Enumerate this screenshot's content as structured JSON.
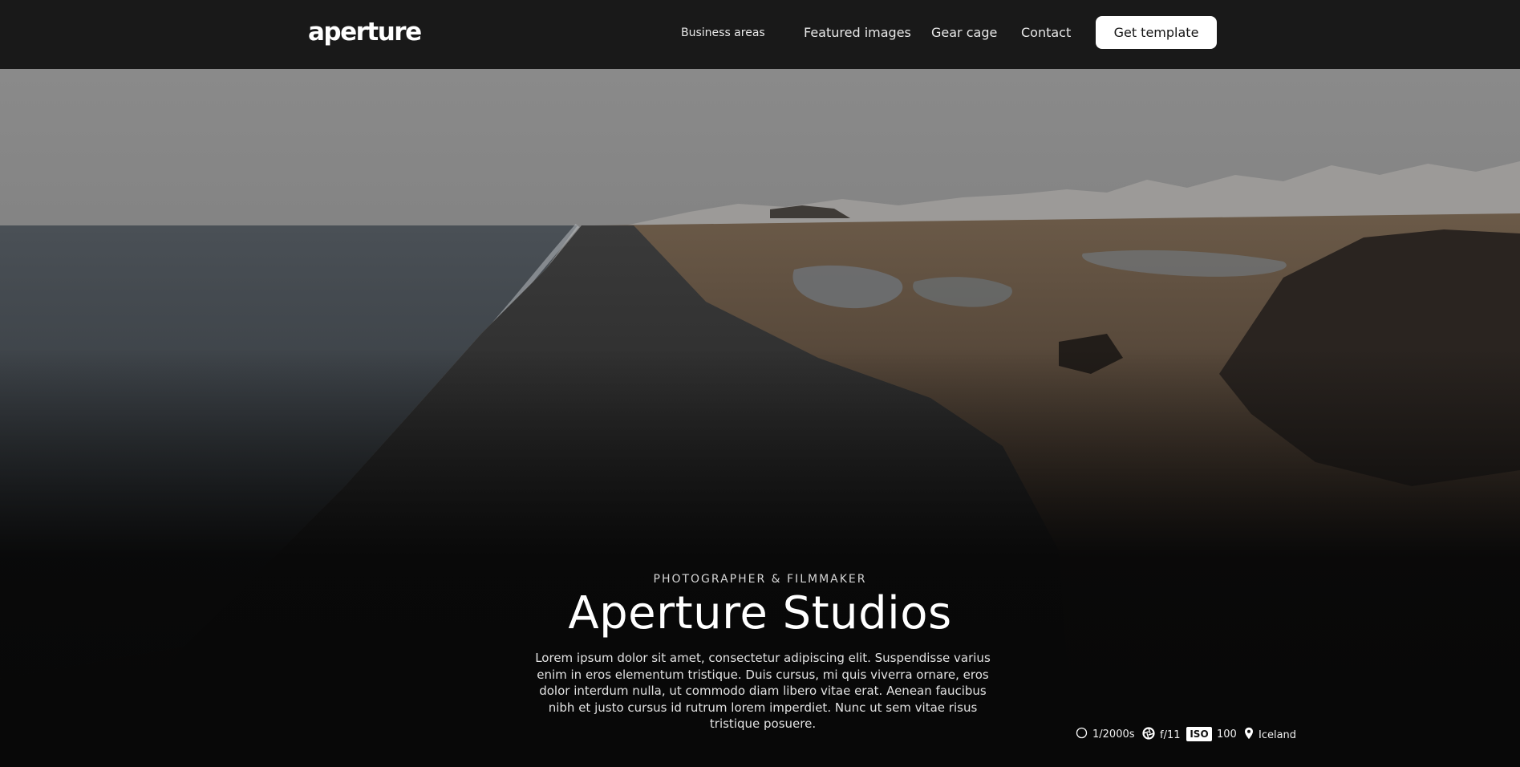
{
  "brand": {
    "logo": "aperture"
  },
  "nav": {
    "business_areas": "Business areas",
    "featured_images": "Featured images",
    "gear_cage": "Gear cage",
    "contact": "Contact",
    "cta": "Get template"
  },
  "hero": {
    "eyebrow": "PHOTOGRAPHER & FILMMAKER",
    "title": "Aperture Studios",
    "description": "Lorem ipsum dolor sit amet, consectetur adipiscing elit. Suspendisse varius enim in eros elementum tristique. Duis cursus, mi quis viverra ornare, eros dolor interdum nulla, ut commodo diam libero vitae erat. Aenean faucibus nibh et justo cursus id rutrum lorem imperdiet. Nunc ut sem vitae risus tristique posuere."
  },
  "exif": {
    "shutter": "1/2000s",
    "aperture": "f/11",
    "iso_label": "ISO",
    "iso": "100",
    "location": "Iceland"
  },
  "colors": {
    "nav_bg": "#191919",
    "cta_bg": "#ffffff",
    "cta_text": "#151515",
    "page_bg": "#080808"
  },
  "icons": [
    "shutter-icon",
    "aperture-icon",
    "iso-icon",
    "location-pin-icon"
  ]
}
